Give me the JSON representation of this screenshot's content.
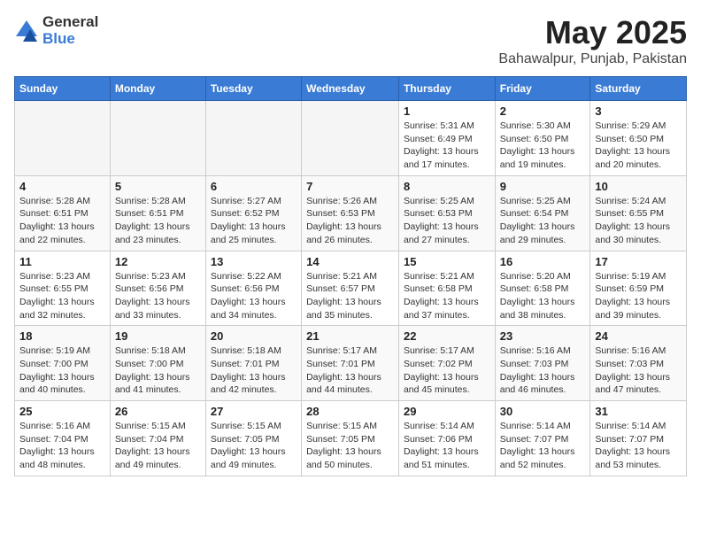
{
  "header": {
    "logo_general": "General",
    "logo_blue": "Blue",
    "title": "May 2025",
    "subtitle": "Bahawalpur, Punjab, Pakistan"
  },
  "calendar": {
    "days_of_week": [
      "Sunday",
      "Monday",
      "Tuesday",
      "Wednesday",
      "Thursday",
      "Friday",
      "Saturday"
    ],
    "weeks": [
      [
        {
          "day": "",
          "info": ""
        },
        {
          "day": "",
          "info": ""
        },
        {
          "day": "",
          "info": ""
        },
        {
          "day": "",
          "info": ""
        },
        {
          "day": "1",
          "info": "Sunrise: 5:31 AM\nSunset: 6:49 PM\nDaylight: 13 hours\nand 17 minutes."
        },
        {
          "day": "2",
          "info": "Sunrise: 5:30 AM\nSunset: 6:50 PM\nDaylight: 13 hours\nand 19 minutes."
        },
        {
          "day": "3",
          "info": "Sunrise: 5:29 AM\nSunset: 6:50 PM\nDaylight: 13 hours\nand 20 minutes."
        }
      ],
      [
        {
          "day": "4",
          "info": "Sunrise: 5:28 AM\nSunset: 6:51 PM\nDaylight: 13 hours\nand 22 minutes."
        },
        {
          "day": "5",
          "info": "Sunrise: 5:28 AM\nSunset: 6:51 PM\nDaylight: 13 hours\nand 23 minutes."
        },
        {
          "day": "6",
          "info": "Sunrise: 5:27 AM\nSunset: 6:52 PM\nDaylight: 13 hours\nand 25 minutes."
        },
        {
          "day": "7",
          "info": "Sunrise: 5:26 AM\nSunset: 6:53 PM\nDaylight: 13 hours\nand 26 minutes."
        },
        {
          "day": "8",
          "info": "Sunrise: 5:25 AM\nSunset: 6:53 PM\nDaylight: 13 hours\nand 27 minutes."
        },
        {
          "day": "9",
          "info": "Sunrise: 5:25 AM\nSunset: 6:54 PM\nDaylight: 13 hours\nand 29 minutes."
        },
        {
          "day": "10",
          "info": "Sunrise: 5:24 AM\nSunset: 6:55 PM\nDaylight: 13 hours\nand 30 minutes."
        }
      ],
      [
        {
          "day": "11",
          "info": "Sunrise: 5:23 AM\nSunset: 6:55 PM\nDaylight: 13 hours\nand 32 minutes."
        },
        {
          "day": "12",
          "info": "Sunrise: 5:23 AM\nSunset: 6:56 PM\nDaylight: 13 hours\nand 33 minutes."
        },
        {
          "day": "13",
          "info": "Sunrise: 5:22 AM\nSunset: 6:56 PM\nDaylight: 13 hours\nand 34 minutes."
        },
        {
          "day": "14",
          "info": "Sunrise: 5:21 AM\nSunset: 6:57 PM\nDaylight: 13 hours\nand 35 minutes."
        },
        {
          "day": "15",
          "info": "Sunrise: 5:21 AM\nSunset: 6:58 PM\nDaylight: 13 hours\nand 37 minutes."
        },
        {
          "day": "16",
          "info": "Sunrise: 5:20 AM\nSunset: 6:58 PM\nDaylight: 13 hours\nand 38 minutes."
        },
        {
          "day": "17",
          "info": "Sunrise: 5:19 AM\nSunset: 6:59 PM\nDaylight: 13 hours\nand 39 minutes."
        }
      ],
      [
        {
          "day": "18",
          "info": "Sunrise: 5:19 AM\nSunset: 7:00 PM\nDaylight: 13 hours\nand 40 minutes."
        },
        {
          "day": "19",
          "info": "Sunrise: 5:18 AM\nSunset: 7:00 PM\nDaylight: 13 hours\nand 41 minutes."
        },
        {
          "day": "20",
          "info": "Sunrise: 5:18 AM\nSunset: 7:01 PM\nDaylight: 13 hours\nand 42 minutes."
        },
        {
          "day": "21",
          "info": "Sunrise: 5:17 AM\nSunset: 7:01 PM\nDaylight: 13 hours\nand 44 minutes."
        },
        {
          "day": "22",
          "info": "Sunrise: 5:17 AM\nSunset: 7:02 PM\nDaylight: 13 hours\nand 45 minutes."
        },
        {
          "day": "23",
          "info": "Sunrise: 5:16 AM\nSunset: 7:03 PM\nDaylight: 13 hours\nand 46 minutes."
        },
        {
          "day": "24",
          "info": "Sunrise: 5:16 AM\nSunset: 7:03 PM\nDaylight: 13 hours\nand 47 minutes."
        }
      ],
      [
        {
          "day": "25",
          "info": "Sunrise: 5:16 AM\nSunset: 7:04 PM\nDaylight: 13 hours\nand 48 minutes."
        },
        {
          "day": "26",
          "info": "Sunrise: 5:15 AM\nSunset: 7:04 PM\nDaylight: 13 hours\nand 49 minutes."
        },
        {
          "day": "27",
          "info": "Sunrise: 5:15 AM\nSunset: 7:05 PM\nDaylight: 13 hours\nand 49 minutes."
        },
        {
          "day": "28",
          "info": "Sunrise: 5:15 AM\nSunset: 7:05 PM\nDaylight: 13 hours\nand 50 minutes."
        },
        {
          "day": "29",
          "info": "Sunrise: 5:14 AM\nSunset: 7:06 PM\nDaylight: 13 hours\nand 51 minutes."
        },
        {
          "day": "30",
          "info": "Sunrise: 5:14 AM\nSunset: 7:07 PM\nDaylight: 13 hours\nand 52 minutes."
        },
        {
          "day": "31",
          "info": "Sunrise: 5:14 AM\nSunset: 7:07 PM\nDaylight: 13 hours\nand 53 minutes."
        }
      ]
    ]
  }
}
